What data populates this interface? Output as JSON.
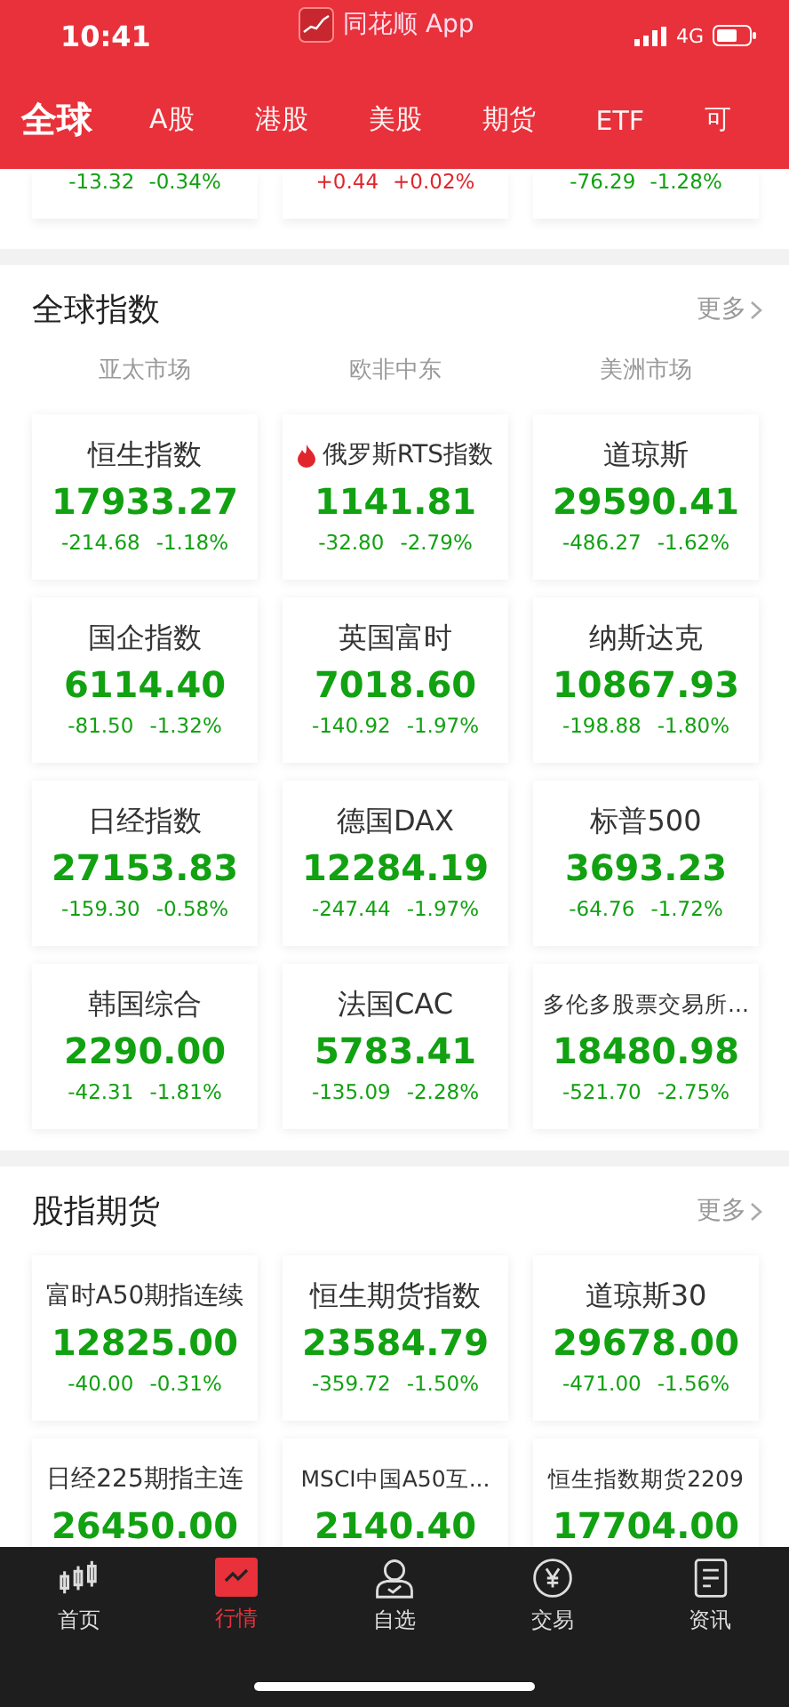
{
  "status_bar": {
    "time": "10:41",
    "app": "同花顺 App",
    "network": "4G"
  },
  "tabs": [
    {
      "label": "全球",
      "selected": true
    },
    {
      "label": "A股",
      "selected": false
    },
    {
      "label": "港股",
      "selected": false
    },
    {
      "label": "美股",
      "selected": false
    },
    {
      "label": "期货",
      "selected": false
    },
    {
      "label": "ETF",
      "selected": false
    },
    {
      "label": "可",
      "selected": false
    }
  ],
  "top_partial_cards": [
    {
      "change": "-13.32",
      "percent": "-0.34%",
      "up": false
    },
    {
      "change": "+0.44",
      "percent": "+0.02%",
      "up": true
    },
    {
      "change": "-76.29",
      "percent": "-1.28%",
      "up": false
    }
  ],
  "sections": [
    {
      "title": "全球指数",
      "more": "更多",
      "regions": [
        "亚太市场",
        "欧非中东",
        "美洲市场"
      ],
      "cards": [
        {
          "name": "恒生指数",
          "value": "17933.27",
          "change": "-214.68",
          "percent": "-1.18%",
          "up": false
        },
        {
          "name": "俄罗斯RTS指数",
          "value": "1141.81",
          "change": "-32.80",
          "percent": "-2.79%",
          "up": false,
          "hot": true
        },
        {
          "name": "道琼斯",
          "value": "29590.41",
          "change": "-486.27",
          "percent": "-1.62%",
          "up": false
        },
        {
          "name": "国企指数",
          "value": "6114.40",
          "change": "-81.50",
          "percent": "-1.32%",
          "up": false
        },
        {
          "name": "英国富时",
          "value": "7018.60",
          "change": "-140.92",
          "percent": "-1.97%",
          "up": false
        },
        {
          "name": "纳斯达克",
          "value": "10867.93",
          "change": "-198.88",
          "percent": "-1.80%",
          "up": false
        },
        {
          "name": "日经指数",
          "value": "27153.83",
          "change": "-159.30",
          "percent": "-0.58%",
          "up": false
        },
        {
          "name": "德国DAX",
          "value": "12284.19",
          "change": "-247.44",
          "percent": "-1.97%",
          "up": false
        },
        {
          "name": "标普500",
          "value": "3693.23",
          "change": "-64.76",
          "percent": "-1.72%",
          "up": false
        },
        {
          "name": "韩国综合",
          "value": "2290.00",
          "change": "-42.31",
          "percent": "-1.81%",
          "up": false
        },
        {
          "name": "法国CAC",
          "value": "5783.41",
          "change": "-135.09",
          "percent": "-2.28%",
          "up": false
        },
        {
          "name": "多伦多股票交易所...",
          "value": "18480.98",
          "change": "-521.70",
          "percent": "-2.75%",
          "up": false
        }
      ]
    },
    {
      "title": "股指期货",
      "more": "更多",
      "cards": [
        {
          "name": "富时A50期指连续",
          "value": "12825.00",
          "change": "-40.00",
          "percent": "-0.31%",
          "up": false
        },
        {
          "name": "恒生期货指数",
          "value": "23584.79",
          "change": "-359.72",
          "percent": "-1.50%",
          "up": false
        },
        {
          "name": "道琼斯30",
          "value": "29678.00",
          "change": "-471.00",
          "percent": "-1.56%",
          "up": false
        },
        {
          "name": "日经225期指主连",
          "value": "26450.00",
          "up": false
        },
        {
          "name": "MSCI中国A50互...",
          "value": "2140.40",
          "up": false
        },
        {
          "name": "恒生指数期货2209",
          "value": "17704.00",
          "up": false
        }
      ]
    }
  ],
  "nav": [
    {
      "label": "首页",
      "kind": "candles",
      "selected": false
    },
    {
      "label": "行情",
      "kind": "chart",
      "selected": true
    },
    {
      "label": "自选",
      "kind": "person",
      "selected": false
    },
    {
      "label": "交易",
      "kind": "yen",
      "selected": false
    },
    {
      "label": "资讯",
      "kind": "doc",
      "selected": false
    }
  ]
}
